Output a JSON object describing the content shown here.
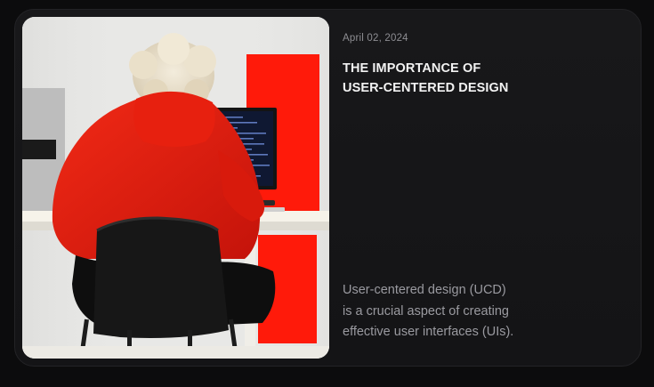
{
  "post": {
    "date": "April 02, 2024",
    "title_lines": [
      "THE IMPORTANCE OF",
      "USER-CENTERED DESIGN"
    ],
    "excerpt_lines": [
      "User-centered design (UCD)",
      "is a crucial aspect of creating",
      "effective user interfaces (UIs)."
    ],
    "image_alt": "Person in red hoodie sitting at desk coding"
  },
  "colors": {
    "card_bg": "#151517",
    "accent_red": "#ff1a0a",
    "page_bg": "#0c0c0d"
  }
}
